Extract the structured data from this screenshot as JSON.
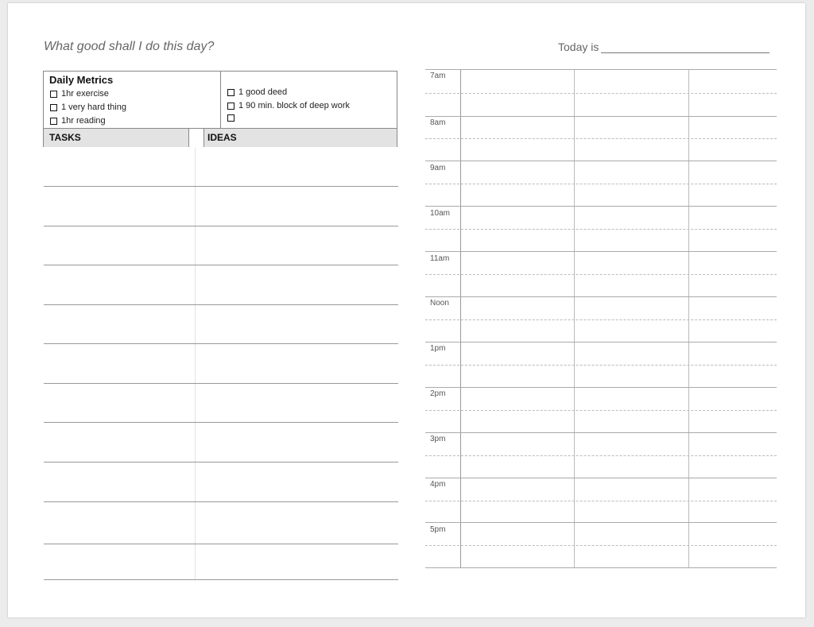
{
  "header": {
    "prompt": "What good shall I do this day?",
    "today_label": "Today is"
  },
  "metrics": {
    "title": "Daily Metrics",
    "left_items": [
      "1hr exercise",
      "1 very hard thing",
      "1hr reading"
    ],
    "right_items": [
      "1 good deed",
      "1 90 min. block of deep work",
      ""
    ]
  },
  "columns": {
    "tasks": "TASKS",
    "ideas": "IDEAS"
  },
  "schedule": {
    "times": [
      "7am",
      "8am",
      "9am",
      "10am",
      "11am",
      "Noon",
      "1pm",
      "2pm",
      "3pm",
      "4pm",
      "5pm"
    ]
  }
}
